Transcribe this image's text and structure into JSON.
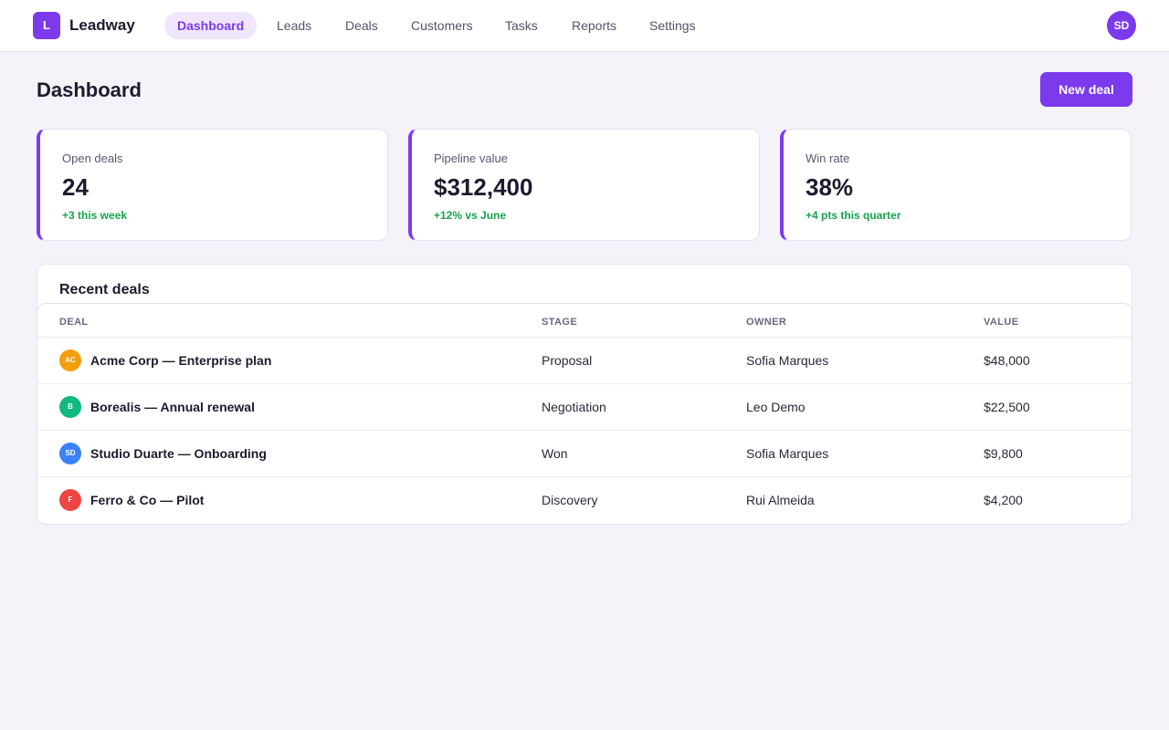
{
  "app": {
    "logo_letter": "L",
    "brand": "Leadway",
    "brand_color": "#7c3aed"
  },
  "nav": {
    "items": [
      {
        "label": "Dashboard",
        "active": true
      },
      {
        "label": "Leads",
        "active": false
      },
      {
        "label": "Deals",
        "active": false
      },
      {
        "label": "Customers",
        "active": false
      },
      {
        "label": "Tasks",
        "active": false
      },
      {
        "label": "Reports",
        "active": false
      },
      {
        "label": "Settings",
        "active": false
      }
    ]
  },
  "user": {
    "initials": "SD"
  },
  "header": {
    "title": "Dashboard",
    "new_deal_label": "New deal"
  },
  "stats": [
    {
      "label": "Open deals",
      "value": "24",
      "delta": "+3 this week"
    },
    {
      "label": "Pipeline value",
      "value": "$312,400",
      "delta": "+12% vs June"
    },
    {
      "label": "Win rate",
      "value": "38%",
      "delta": "+4 pts this quarter"
    }
  ],
  "recent_deals": {
    "title": "Recent deals",
    "columns": {
      "deal": "DEAL",
      "stage": "STAGE",
      "owner": "OWNER",
      "value": "VALUE"
    },
    "rows": [
      {
        "initials": "AC",
        "color": "#f59e0b",
        "deal": "Acme Corp — Enterprise plan",
        "stage": "Proposal",
        "owner": "Sofia Marques",
        "value": "$48,000"
      },
      {
        "initials": "B",
        "color": "#10b981",
        "deal": "Borealis — Annual renewal",
        "stage": "Negotiation",
        "owner": "Leo Demo",
        "value": "$22,500"
      },
      {
        "initials": "SD",
        "color": "#3b82f6",
        "deal": "Studio Duarte — Onboarding",
        "stage": "Won",
        "owner": "Sofia Marques",
        "value": "$9,800"
      },
      {
        "initials": "F",
        "color": "#ef4444",
        "deal": "Ferro & Co — Pilot",
        "stage": "Discovery",
        "owner": "Rui Almeida",
        "value": "$4,200"
      }
    ]
  },
  "colors": {
    "delta_positive": "#16a34a",
    "background": "#f5f3f9"
  }
}
